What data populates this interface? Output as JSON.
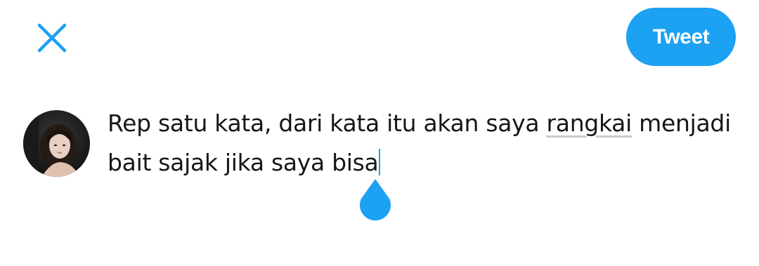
{
  "header": {
    "close_icon": "close-icon",
    "tweet_label": "Tweet"
  },
  "composer": {
    "avatar_icon": "avatar",
    "text_line1_before": "Rep satu kata, dari kata itu akan saya ",
    "text_line1_flagged": "rangkai",
    "text_line1_after": " menjadi",
    "text_line2": "bait sajak jika saya bisa",
    "cursor_handle_icon": "text-cursor-handle-icon"
  },
  "colors": {
    "accent": "#1da1f2",
    "text": "#14171a",
    "background": "#ffffff",
    "spellcheck_underline": "#c9c9c9"
  }
}
